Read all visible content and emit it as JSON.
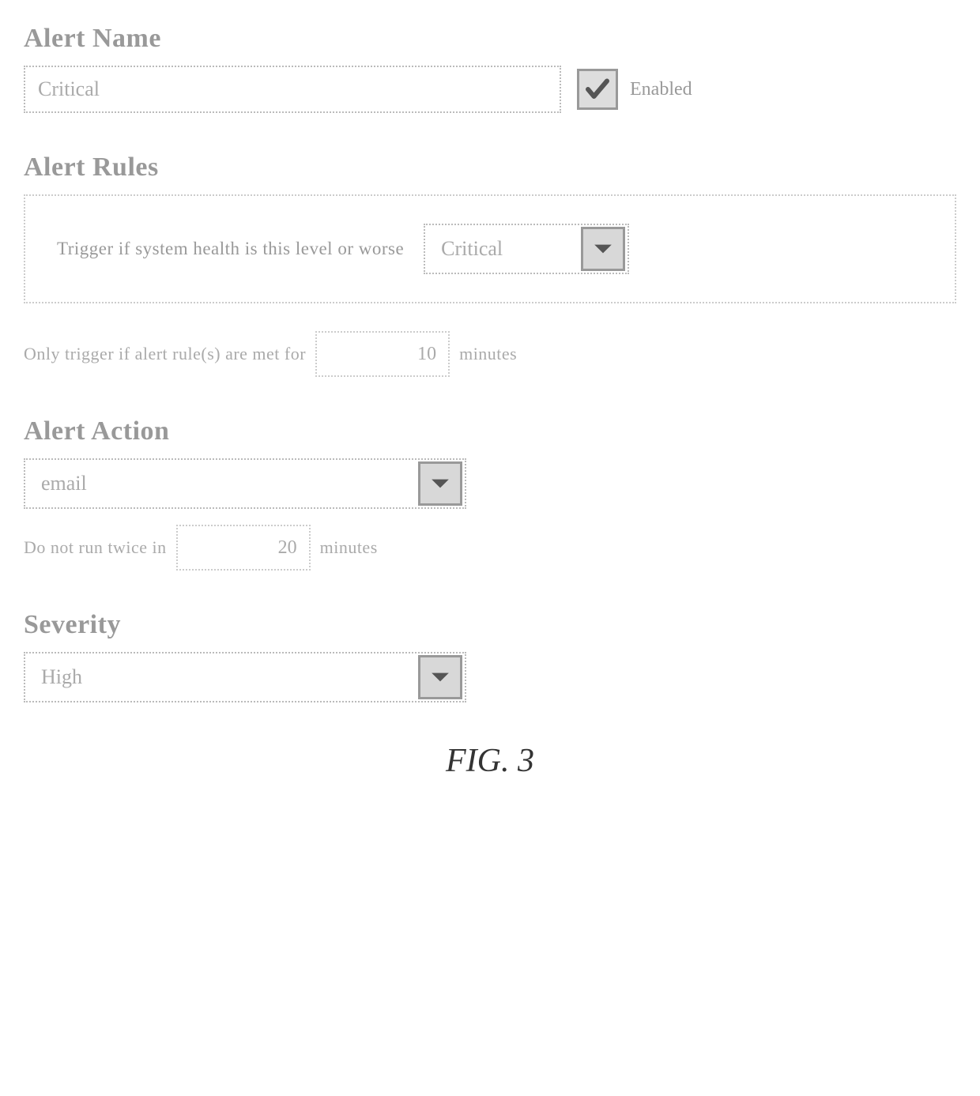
{
  "alert_name": {
    "heading": "Alert Name",
    "value": "Critical",
    "enabled_label": "Enabled"
  },
  "alert_rules": {
    "heading": "Alert Rules",
    "trigger_text": "Trigger if system health is this level or worse",
    "level_value": "Critical",
    "duration_prefix": "Only trigger if alert rule(s) are met for",
    "duration_value": "10",
    "duration_suffix": "minutes"
  },
  "alert_action": {
    "heading": "Alert Action",
    "value": "email",
    "throttle_prefix": "Do not run twice in",
    "throttle_value": "20",
    "throttle_suffix": "minutes"
  },
  "severity": {
    "heading": "Severity",
    "value": "High"
  },
  "figure_label": "FIG. 3"
}
